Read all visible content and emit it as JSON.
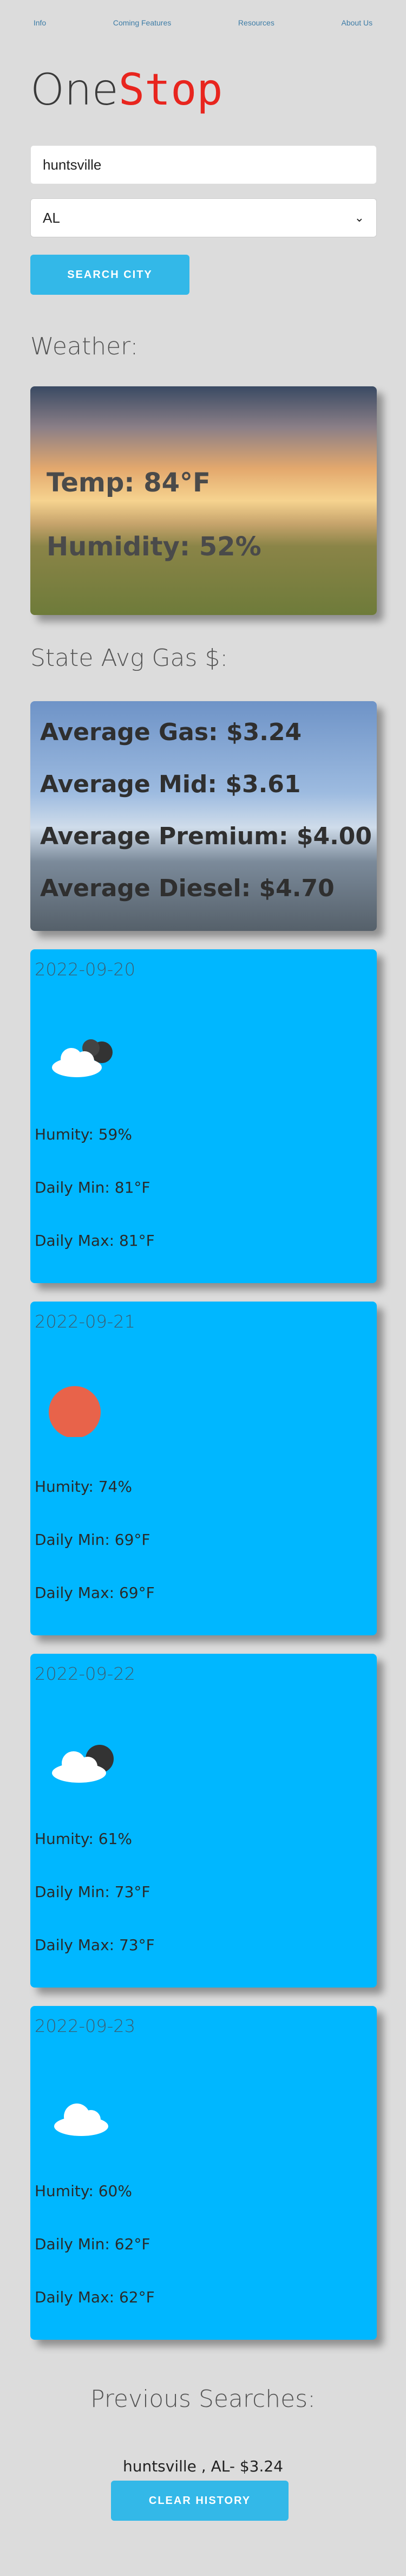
{
  "nav": {
    "info": "Info",
    "coming": "Coming Features",
    "resources": "Resources",
    "about": "About Us"
  },
  "logo": {
    "part1": "One",
    "part2": "Stop"
  },
  "search": {
    "city_value": "huntsville",
    "state_value": "AL",
    "button": "SEARCH CITY"
  },
  "weather": {
    "heading": "Weather:",
    "temp": "Temp: 84°F",
    "humidity": "Humidity: 52%"
  },
  "gas": {
    "heading": "State Avg Gas $:",
    "average": "Average Gas: $3.24",
    "mid": "Average Mid: $3.61",
    "premium": "Average Premium: $4.00",
    "diesel": "Average Diesel: $4.70"
  },
  "forecast": [
    {
      "date": "2022-09-20",
      "icon": "dark-clouds-icon",
      "humidity": "Humity: 59%",
      "min": "Daily Min: 81°F",
      "max": "Daily Max: 81°F"
    },
    {
      "date": "2022-09-21",
      "icon": "sun-icon",
      "humidity": "Humity: 74%",
      "min": "Daily Min: 69°F",
      "max": "Daily Max: 69°F"
    },
    {
      "date": "2022-09-22",
      "icon": "cloud-icon",
      "humidity": "Humity: 61%",
      "min": "Daily Min: 73°F",
      "max": "Daily Max: 73°F"
    },
    {
      "date": "2022-09-23",
      "icon": "cloud-icon",
      "humidity": "Humity: 60%",
      "min": "Daily Min: 62°F",
      "max": "Daily Max: 62°F"
    }
  ],
  "history": {
    "heading": "Previous Searches:",
    "item": "huntsville , AL- $3.24",
    "clear": "CLEAR HISTORY"
  }
}
